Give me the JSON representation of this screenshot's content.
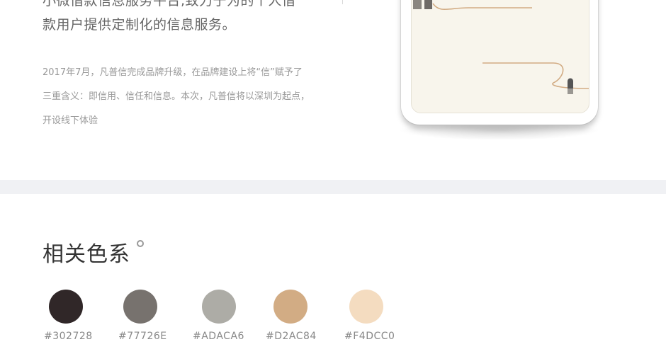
{
  "intro": {
    "headline_lines": [
      "小微借款信息服务平台,致力于为的个人借",
      "款用户提供定制化的信息服务。"
    ],
    "description_lines": [
      "2017年7月，凡普信完成品牌升级，在品牌建设上将“信”赋予了",
      "三重含义：即信用、信任和信息。本次，凡普信将以深圳为起点，",
      "开设线下体验"
    ]
  },
  "phone": {
    "screen_color": "#f8f5ec",
    "accent_line_color": "#d2ac84",
    "figure_color": "#555555"
  },
  "colors_section": {
    "title": "相关色系",
    "swatches": [
      {
        "hex": "#302728",
        "label": "#302728"
      },
      {
        "hex": "#77726E",
        "label": "#77726E"
      },
      {
        "hex": "#ADACA6",
        "label": "#ADACA6"
      },
      {
        "hex": "#D2AC84",
        "label": "#D2AC84"
      },
      {
        "hex": "#F4DCC0",
        "label": "#F4DCC0"
      }
    ]
  },
  "band_color": "#f0f1f4"
}
